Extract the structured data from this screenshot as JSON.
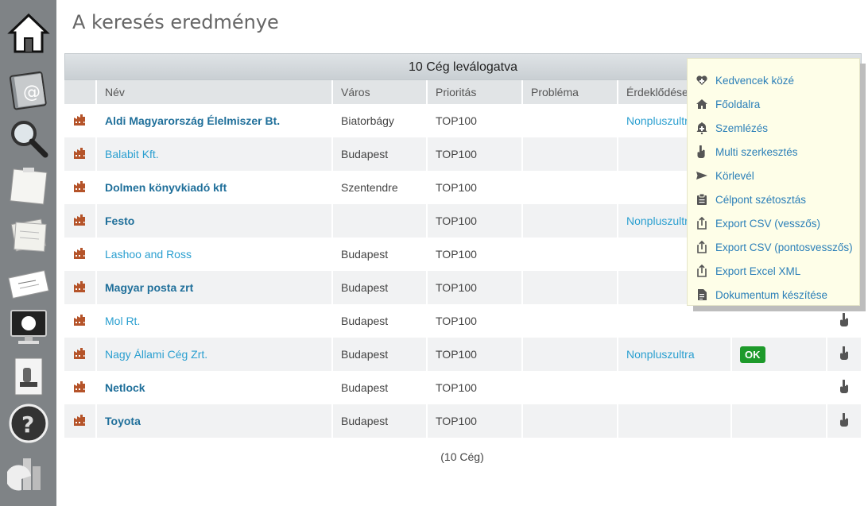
{
  "page": {
    "title": "A keresés eredménye"
  },
  "sidebar": {
    "items": [
      {
        "name": "home-icon"
      },
      {
        "name": "address-book-icon"
      },
      {
        "name": "magnifier-icon"
      },
      {
        "name": "sticky-note-icon"
      },
      {
        "name": "notes-stack-icon"
      },
      {
        "name": "business-card-icon"
      },
      {
        "name": "monitor-icon"
      },
      {
        "name": "document-icon"
      },
      {
        "name": "help-icon"
      },
      {
        "name": "chart-icon"
      }
    ]
  },
  "table": {
    "caption": "10 Cég leválogatva",
    "headers": {
      "name": "Név",
      "city": "Város",
      "priority": "Prioritás",
      "problem": "Probléma",
      "interest": "Érdeklődése"
    },
    "rows": [
      {
        "name": "Aldi Magyarország Élelmiszer Bt.",
        "city": "Biatorbágy",
        "priority": "TOP100",
        "problem": "",
        "interest": "Nonpluszultra",
        "status": "",
        "bold": true
      },
      {
        "name": "Balabit Kft.",
        "city": "Budapest",
        "priority": "TOP100",
        "problem": "",
        "interest": "",
        "status": "",
        "bold": false
      },
      {
        "name": "Dolmen könyvkiadó kft",
        "city": "Szentendre",
        "priority": "TOP100",
        "problem": "",
        "interest": "",
        "status": "",
        "bold": true
      },
      {
        "name": "Festo",
        "city": "",
        "priority": "TOP100",
        "problem": "",
        "interest": "Nonpluszultra",
        "status": "",
        "bold": true
      },
      {
        "name": "Lashoo and Ross",
        "city": "Budapest",
        "priority": "TOP100",
        "problem": "",
        "interest": "",
        "status": "",
        "bold": false
      },
      {
        "name": "Magyar posta zrt",
        "city": "Budapest",
        "priority": "TOP100",
        "problem": "",
        "interest": "",
        "status": "",
        "bold": true
      },
      {
        "name": "Mol Rt.",
        "city": "Budapest",
        "priority": "TOP100",
        "problem": "",
        "interest": "",
        "status": "",
        "bold": false
      },
      {
        "name": "Nagy Állami Cég Zrt.",
        "city": "Budapest",
        "priority": "TOP100",
        "problem": "",
        "interest": "Nonpluszultra",
        "status": "OK",
        "bold": false
      },
      {
        "name": "Netlock",
        "city": "Budapest",
        "priority": "TOP100",
        "problem": "",
        "interest": "",
        "status": "",
        "bold": true
      },
      {
        "name": "Toyota",
        "city": "Budapest",
        "priority": "TOP100",
        "problem": "",
        "interest": "",
        "status": "",
        "bold": true
      }
    ],
    "footer": "(10 Cég)"
  },
  "menu": {
    "items": [
      {
        "label": "Kedvencek közé",
        "icon": "heart-plus-icon"
      },
      {
        "label": "Főoldalra",
        "icon": "home-small-icon"
      },
      {
        "label": "Szemlézés",
        "icon": "bell-plus-icon"
      },
      {
        "label": "Multi szerkesztés",
        "icon": "hand-pointer-icon"
      },
      {
        "label": "Körlevél",
        "icon": "send-icon"
      },
      {
        "label": "Célpont szétosztás",
        "icon": "clipboard-icon"
      },
      {
        "label": "Export CSV (vesszős)",
        "icon": "export-icon"
      },
      {
        "label": "Export CSV (pontosvesszős)",
        "icon": "export-icon"
      },
      {
        "label": "Export Excel XML",
        "icon": "export-icon"
      },
      {
        "label": "Dokumentum készítése",
        "icon": "file-icon"
      }
    ]
  },
  "colors": {
    "sidebar": "#7f8386",
    "link": "#2a9fd0",
    "link_bold": "#1f6f9a",
    "factory": "#b5542a",
    "ok": "#1d9a2a",
    "menu_bg": "#fefee8"
  }
}
